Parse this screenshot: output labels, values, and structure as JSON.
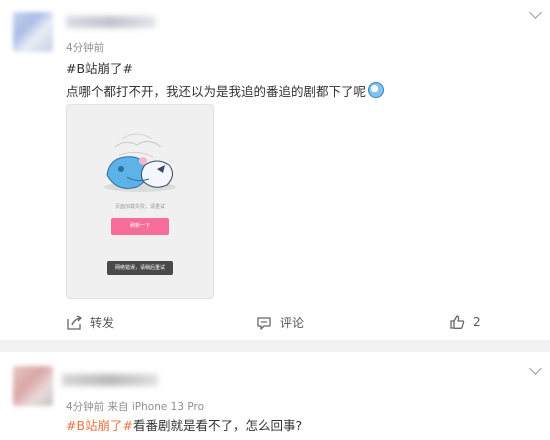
{
  "posts": [
    {
      "time": "4分钟前",
      "device": "",
      "tag": "#B站崩了#",
      "text": "点哪个都打不开，我还以为是我追的番追的剧都下了呢",
      "screenshot": {
        "error_text": "页面加载失败，请重试",
        "retry_label": "刷新一下",
        "toast_text": "网络错误，请稍后重试"
      },
      "actions": {
        "share_label": "转发",
        "comment_label": "评论",
        "like_count": "2"
      }
    },
    {
      "time": "4分钟前",
      "device": "来自 iPhone 13 Pro",
      "tag": "#B站崩了#",
      "text": "看番剧就是看不了，怎么回事?"
    }
  ],
  "icons": {
    "share": "share-icon",
    "comment": "comment-icon",
    "like": "thumbs-up-icon",
    "more": "chevron-down-icon"
  },
  "colors": {
    "tag": "#eb7340",
    "retry_button": "#f76d9a",
    "separator": "#f2f2f2"
  }
}
